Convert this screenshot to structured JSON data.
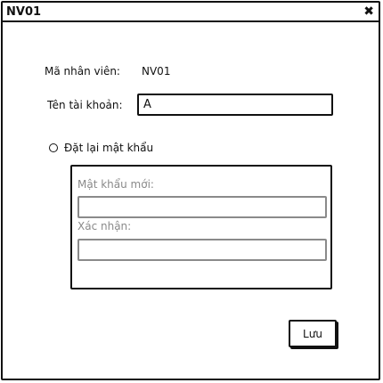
{
  "window": {
    "title": "NV01",
    "close_icon": "close-icon"
  },
  "form": {
    "employee_code_label": "Mã nhân viên:",
    "employee_code_value": "NV01",
    "account_name_label": "Tên tài khoản:",
    "account_name_value": "A",
    "reset_password_label": "Đặt lại mật khẩu",
    "reset_password_checked": false,
    "new_password_label": "Mật khẩu mới:",
    "new_password_value": "",
    "confirm_label": "Xác nhận:",
    "confirm_value": ""
  },
  "actions": {
    "save_label": "Lưu"
  }
}
